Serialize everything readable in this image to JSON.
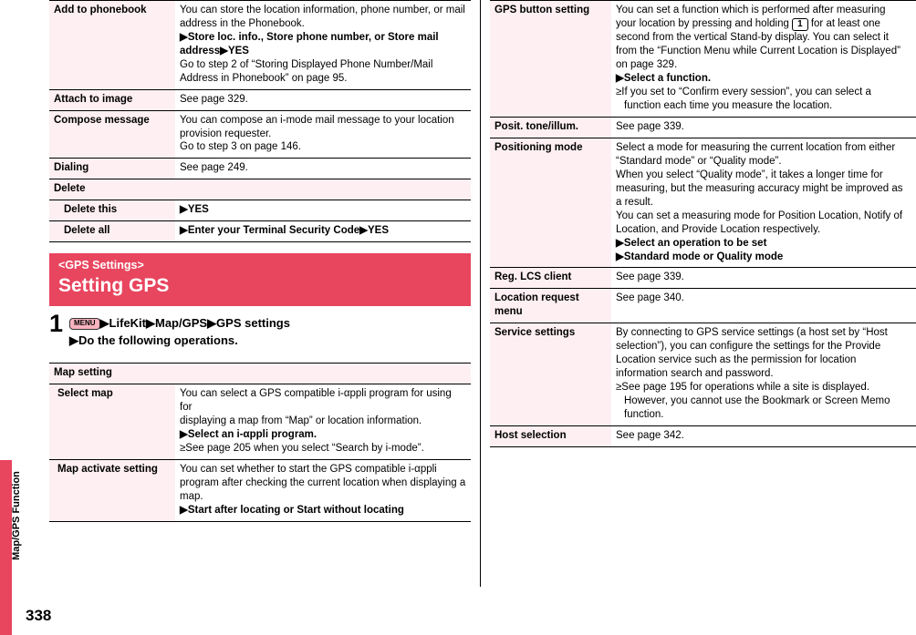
{
  "page": {
    "number": "338",
    "spine_label": "Map/GPS Function"
  },
  "left_column": {
    "table_top": {
      "rows": [
        {
          "type": "row",
          "label": "Add to phonebook",
          "lines": [
            {
              "t": "You can store the location information, phone number, or mail"
            },
            {
              "t": "address in the Phonebook."
            },
            {
              "t": "▶Store loc. info., Store phone number, or Store mail",
              "bold": true
            },
            {
              "t": "address▶YES",
              "bold": true
            },
            {
              "t": "Go to step 2 of “Storing Displayed Phone Number/Mail"
            },
            {
              "t": "Address in Phonebook” on page 95."
            }
          ]
        },
        {
          "type": "row",
          "label": "Attach to image",
          "lines": [
            {
              "t": "See page 329."
            }
          ]
        },
        {
          "type": "row",
          "label": "Compose message",
          "lines": [
            {
              "t": "You can compose an i-mode mail message to your location"
            },
            {
              "t": "provision requester."
            },
            {
              "t": "Go to step 3 on page 146."
            }
          ]
        },
        {
          "type": "row",
          "label": "Dialing",
          "lines": [
            {
              "t": "See page 249."
            }
          ]
        },
        {
          "type": "fullheader",
          "label": "Delete"
        },
        {
          "type": "subrow",
          "label": "Delete this",
          "lines": [
            {
              "t": "▶YES",
              "bold": true
            }
          ]
        },
        {
          "type": "subrow",
          "label": "Delete all",
          "lines": [
            {
              "t": "▶Enter your Terminal Security Code▶YES",
              "bold": true
            }
          ]
        }
      ]
    },
    "section": {
      "sub": "<GPS Settings>",
      "title": "Setting GPS"
    },
    "step": {
      "number": "1",
      "menu_key": "MENU",
      "line1_rest": "▶LifeKit▶Map/GPS▶GPS settings",
      "line2": "▶Do the following operations."
    },
    "table_bottom": {
      "rows": [
        {
          "type": "fullheader",
          "label": "Map setting"
        },
        {
          "type": "subrow2",
          "label": "Select map",
          "lines": [
            {
              "t": "You can select a GPS compatible i-αppli program for using for"
            },
            {
              "t": "displaying a map from “Map” or location information."
            },
            {
              "t": "▶Select an i-αppli program.",
              "bold": true
            },
            {
              "t": "≥See page 205 when you select “Search by i-mode”.",
              "bullet": true
            }
          ]
        },
        {
          "type": "subrow2",
          "label": "Map activate setting",
          "lines": [
            {
              "t": "You can set whether to start the GPS compatible i-αppli"
            },
            {
              "t": "program after checking the current location when displaying a"
            },
            {
              "t": "map."
            },
            {
              "t": "▶Start after locating or Start without locating",
              "bold": true
            }
          ]
        }
      ]
    }
  },
  "right_column": {
    "table": {
      "rows": [
        {
          "type": "row",
          "label": "GPS button setting",
          "lines": [
            {
              "t": "You can set a function which is performed after measuring"
            },
            {
              "t": "your location by pressing and holding [1] for at least one",
              "key": "1"
            },
            {
              "t": "second from the vertical Stand-by display. You can select it"
            },
            {
              "t": "from the “Function Menu while Current Location is Displayed”"
            },
            {
              "t": "on page 329."
            },
            {
              "t": "▶Select a function.",
              "bold": true
            },
            {
              "t": "≥If you set to “Confirm every session”, you can select a",
              "bullet": true
            },
            {
              "t": "function each time you measure the location.",
              "cont": true
            }
          ]
        },
        {
          "type": "row",
          "label": "Posit. tone/illum.",
          "lines": [
            {
              "t": "See page 339."
            }
          ]
        },
        {
          "type": "row",
          "label": "Positioning mode",
          "lines": [
            {
              "t": "Select a mode for measuring the current location from either"
            },
            {
              "t": "“Standard mode” or “Quality mode”."
            },
            {
              "t": "When you select “Quality mode”, it takes a longer time for"
            },
            {
              "t": "measuring, but the measuring accuracy might be improved as"
            },
            {
              "t": "a result."
            },
            {
              "t": "You can set a measuring mode for Position Location, Notify of"
            },
            {
              "t": "Location, and Provide Location respectively."
            },
            {
              "t": "▶Select an operation to be set",
              "bold": true
            },
            {
              "t": "▶Standard mode or Quality mode",
              "bold": true
            }
          ]
        },
        {
          "type": "row",
          "label": "Reg. LCS client",
          "lines": [
            {
              "t": "See page 339."
            }
          ]
        },
        {
          "type": "row",
          "label": "Location request menu",
          "lines": [
            {
              "t": "See page 340."
            }
          ]
        },
        {
          "type": "row",
          "label": "Service settings",
          "lines": [
            {
              "t": "By connecting to GPS service settings (a host set by “Host"
            },
            {
              "t": "selection”), you can configure the settings for the Provide"
            },
            {
              "t": "Location service such as the permission for location"
            },
            {
              "t": "information search and password."
            },
            {
              "t": "≥See page 195 for operations while a site is displayed.",
              "bullet": true
            },
            {
              "t": "However, you cannot use the Bookmark or Screen Memo",
              "cont": true
            },
            {
              "t": "function.",
              "cont": true
            }
          ]
        },
        {
          "type": "row",
          "label": "Host selection",
          "lines": [
            {
              "t": "See page 342."
            }
          ]
        }
      ]
    }
  }
}
